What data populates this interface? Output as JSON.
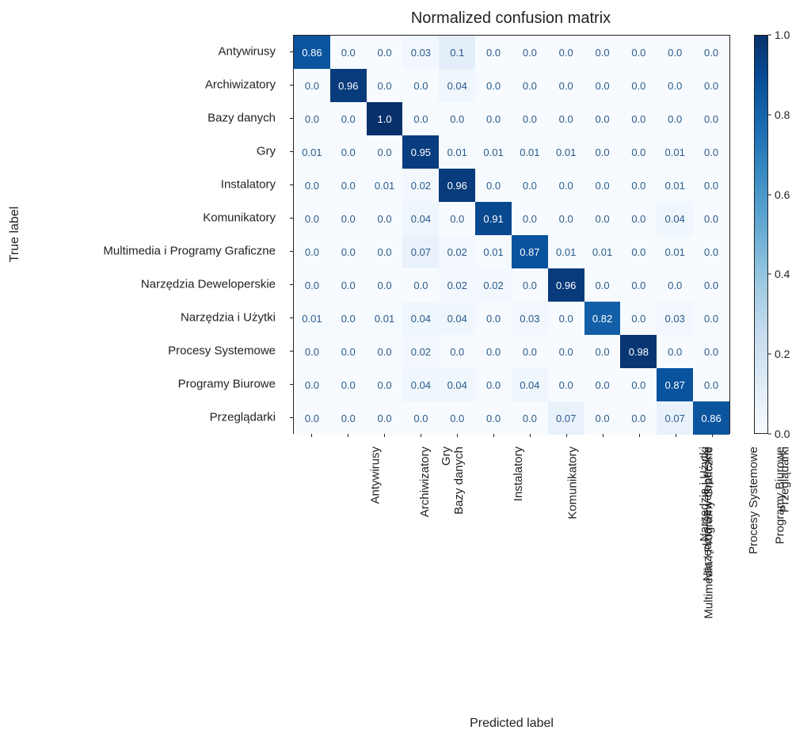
{
  "chart_data": {
    "type": "heatmap",
    "title": "Normalized confusion matrix",
    "xlabel": "Predicted label",
    "ylabel": "True label",
    "categories": [
      "Antywirusy",
      "Archiwizatory",
      "Bazy danych",
      "Gry",
      "Instalatory",
      "Komunikatory",
      "Multimedia i Programy Graficzne",
      "Narzędzia Deweloperskie",
      "Narzędzia i Użytki",
      "Procesy Systemowe",
      "Programy Biurowe",
      "Przeglądarki"
    ],
    "matrix": [
      [
        0.86,
        0.0,
        0.0,
        0.03,
        0.1,
        0.0,
        0.0,
        0.0,
        0.0,
        0.0,
        0.0,
        0.0
      ],
      [
        0.0,
        0.96,
        0.0,
        0.0,
        0.04,
        0.0,
        0.0,
        0.0,
        0.0,
        0.0,
        0.0,
        0.0
      ],
      [
        0.0,
        0.0,
        1.0,
        0.0,
        0.0,
        0.0,
        0.0,
        0.0,
        0.0,
        0.0,
        0.0,
        0.0
      ],
      [
        0.01,
        0.0,
        0.0,
        0.95,
        0.01,
        0.01,
        0.01,
        0.01,
        0.0,
        0.0,
        0.01,
        0.0
      ],
      [
        0.0,
        0.0,
        0.01,
        0.02,
        0.96,
        0.0,
        0.0,
        0.0,
        0.0,
        0.0,
        0.01,
        0.0
      ],
      [
        0.0,
        0.0,
        0.0,
        0.04,
        0.0,
        0.91,
        0.0,
        0.0,
        0.0,
        0.0,
        0.04,
        0.0
      ],
      [
        0.0,
        0.0,
        0.0,
        0.07,
        0.02,
        0.01,
        0.87,
        0.01,
        0.01,
        0.0,
        0.01,
        0.0
      ],
      [
        0.0,
        0.0,
        0.0,
        0.0,
        0.02,
        0.02,
        0.0,
        0.96,
        0.0,
        0.0,
        0.0,
        0.0
      ],
      [
        0.01,
        0.0,
        0.01,
        0.04,
        0.04,
        0.0,
        0.03,
        0.0,
        0.82,
        0.0,
        0.03,
        0.0
      ],
      [
        0.0,
        0.0,
        0.0,
        0.02,
        0.0,
        0.0,
        0.0,
        0.0,
        0.0,
        0.98,
        0.0,
        0.0
      ],
      [
        0.0,
        0.0,
        0.0,
        0.04,
        0.04,
        0.0,
        0.04,
        0.0,
        0.0,
        0.0,
        0.87,
        0.0
      ],
      [
        0.0,
        0.0,
        0.0,
        0.0,
        0.0,
        0.0,
        0.0,
        0.07,
        0.0,
        0.0,
        0.07,
        0.86
      ]
    ],
    "colorbar_ticks": [
      0.0,
      0.2,
      0.4,
      0.6,
      0.8,
      1.0
    ],
    "value_range": [
      0.0,
      1.0
    ]
  }
}
